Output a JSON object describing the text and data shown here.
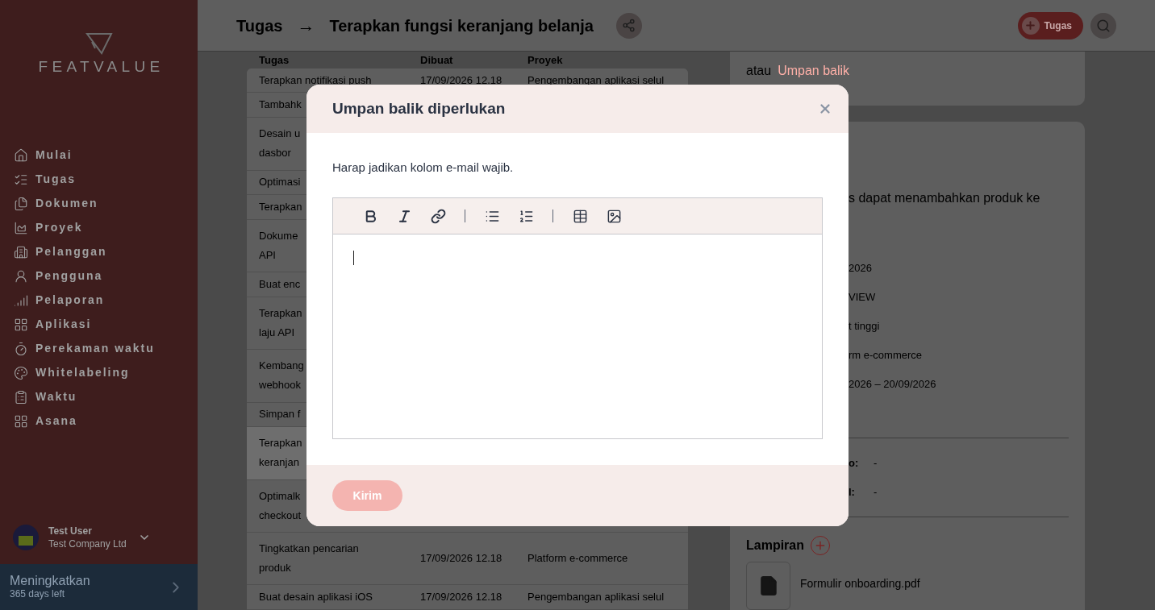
{
  "sidebar": {
    "logo_text": "FEATVALUE",
    "nav": [
      {
        "label": "Mulai"
      },
      {
        "label": "Tugas"
      },
      {
        "label": "Dokumen"
      },
      {
        "label": "Proyek"
      },
      {
        "label": "Pelanggan"
      },
      {
        "label": "Pengguna"
      },
      {
        "label": "Pelaporan"
      },
      {
        "label": "Aplikasi"
      },
      {
        "label": "Perekaman waktu"
      },
      {
        "label": "Whitelabeling"
      },
      {
        "label": "Waktu"
      },
      {
        "label": "Asana"
      }
    ],
    "user": {
      "name": "Test User",
      "company": "Test Company Ltd"
    },
    "upgrade": {
      "title": "Meningkatkan",
      "subtitle": "365 days left"
    }
  },
  "header": {
    "breadcrumb": "Tugas",
    "arrow": "→",
    "title": "Terapkan fungsi keranjang belanja",
    "new_button": "Tugas"
  },
  "table": {
    "columns": [
      "Tugas",
      "Dibuat",
      "Proyek"
    ],
    "rows": [
      {
        "task": [
          "Terapkan notifikasi push"
        ],
        "created": "17/09/2026 12.18",
        "project": "Pengembangan aplikasi selul",
        "selected": false
      },
      {
        "task": [
          "Tambahk"
        ],
        "selected": false
      },
      {
        "task": [
          "Desain u",
          "dasbor"
        ],
        "selected": false
      },
      {
        "task": [
          "Optimasi"
        ],
        "selected": false
      },
      {
        "task": [
          "Terapkan"
        ],
        "selected": false
      },
      {
        "task": [
          "Dokume",
          "API"
        ],
        "selected": false
      },
      {
        "task": [
          "Buat enc"
        ],
        "selected": false
      },
      {
        "task": [
          "Terapkan",
          "laju API"
        ],
        "selected": false
      },
      {
        "task": [
          "Kembang",
          "webhook"
        ],
        "selected": false
      },
      {
        "task": [
          "Simpan f"
        ],
        "selected": false
      },
      {
        "task": [
          "Terapkan",
          "keranjan"
        ],
        "selected": true
      },
      {
        "task": [
          "Optimalk",
          "checkout"
        ],
        "selected": false
      },
      {
        "task": [
          "Tingkatkan pencarian",
          "produk"
        ],
        "created": "17/09/2026 12.18",
        "project": "Platform e-commerce",
        "selected": false
      },
      {
        "task": [
          "Buat desain aplikasi iOS"
        ],
        "created": "17/09/2026 12.18",
        "project": "Pengembangan aplikasi selul",
        "selected": false
      }
    ]
  },
  "detail": {
    "or_text": "atau",
    "feedback_link": "Umpan balik",
    "description": "s dapat menambahkan produk ke",
    "values": [
      "2026",
      "VIEW",
      "t tinggi",
      "rm e-commerce",
      "2026 – 20/09/2026"
    ],
    "fields": [
      {
        "label": "o:",
        "value": "-"
      },
      {
        "label": "l:",
        "value": "-"
      }
    ],
    "attachments_title": "Lampiran",
    "attachments": [
      {
        "name": "Formulir onboarding.pdf"
      }
    ]
  },
  "modal": {
    "title": "Umpan balik diperlukan",
    "message": "Harap jadikan kolom e-mail wajib.",
    "submit": {
      "label": "Kirim",
      "disabled": true
    }
  }
}
